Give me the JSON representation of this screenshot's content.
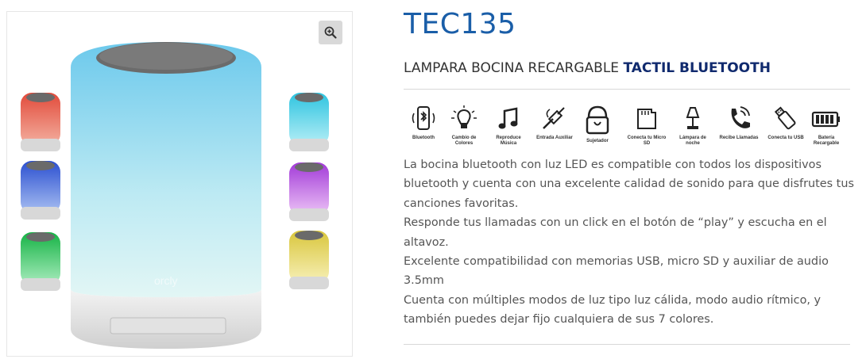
{
  "product": {
    "sku": "TEC135",
    "subtitle_regular": "LAMPARA BOCINA RECARGABLE",
    "subtitle_bold": "TACTIL BLUETOOTH"
  },
  "gallery": {
    "zoom_icon": "zoom-in-icon",
    "brand_text": "orcly",
    "colors": {
      "lamp_main": "#8fd6ea",
      "red": "#e8584a",
      "blue": "#3a63d8",
      "green": "#2ec05a",
      "cyan": "#4fd2e6",
      "purple": "#b25ae0",
      "yellow": "#e8d85a"
    }
  },
  "features": [
    {
      "label": "Bluetooth",
      "icon": "bluetooth-phone-icon"
    },
    {
      "label": "Cambio de Colores",
      "icon": "bulb-icon"
    },
    {
      "label": "Reproduce Música",
      "icon": "music-note-icon"
    },
    {
      "label": "Entrada Auxiliar",
      "icon": "aux-cable-icon"
    },
    {
      "label": "Sujetador",
      "icon": "handle-icon"
    },
    {
      "label": "Conecta tu Micro SD",
      "icon": "micro-sd-icon"
    },
    {
      "label": "Lámpara de noche",
      "icon": "night-lamp-icon"
    },
    {
      "label": "Recibe Llamadas",
      "icon": "phone-call-icon"
    },
    {
      "label": "Conecta tu USB",
      "icon": "usb-icon"
    },
    {
      "label": "Batería Recargable",
      "icon": "battery-icon"
    }
  ],
  "description": [
    "La bocina bluetooth con luz LED es compatible con todos los dispositivos bluetooth y cuenta con una excelente calidad de sonido para que disfrutes tus canciones favoritas.",
    "Responde tus llamadas con un click en el botón de “play” y escucha en el altavoz.",
    "Excelente compatibilidad con memorias USB, micro SD y auxiliar de audio 3.5mm",
    "Cuenta con múltiples modos de luz tipo luz cálida, modo audio rítmico, y también puedes dejar fijo cualquiera de sus 7 colores."
  ]
}
